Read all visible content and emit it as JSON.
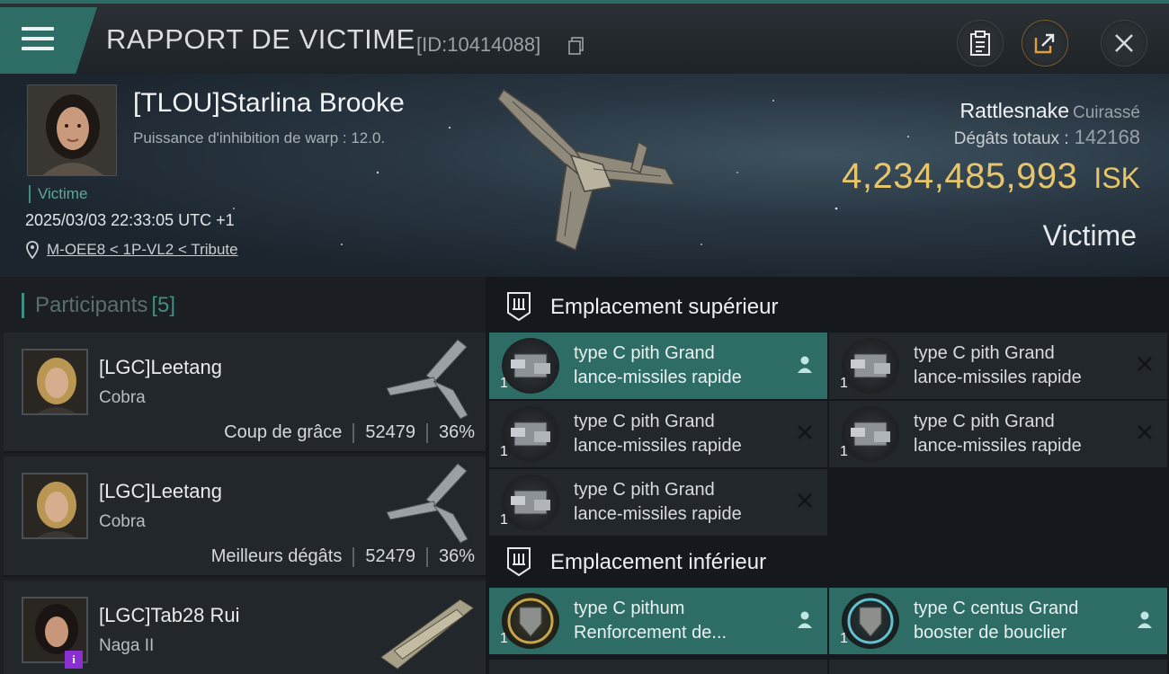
{
  "header": {
    "title": "RAPPORT DE VICTIME",
    "report_id": "[ID:10414088]",
    "buttons": [
      {
        "name": "clipboard-icon"
      },
      {
        "name": "share-icon"
      },
      {
        "name": "close-icon"
      }
    ]
  },
  "victim": {
    "name": "[TLOU]Starlina Brooke",
    "subtitle": "Puissance d'inhibition de warp : 12.0.",
    "tag": "Victime",
    "datetime": "2025/03/03 22:33:05 UTC +1",
    "location": "M-OEE8 < 1P-VL2 < Tribute",
    "ship_name": "Rattlesnake",
    "ship_class": "Cuirassé",
    "damage_label": "Dégâts totaux :",
    "damage_value": "142168",
    "isk_value": "4,234,485,993",
    "isk_unit": "ISK",
    "role": "Victime"
  },
  "participants": {
    "label": "Participants",
    "count": "[5]",
    "items": [
      {
        "name": "[LGC]Leetang",
        "ship": "Cobra",
        "tag": "Coup de grâce",
        "damage": "52479",
        "percent": "36%"
      },
      {
        "name": "[LGC]Leetang",
        "ship": "Cobra",
        "tag": "Meilleurs dégâts",
        "damage": "52479",
        "percent": "36%"
      },
      {
        "name": "[LGC]Tab28 Rui",
        "ship": "Naga II",
        "badge": "i"
      }
    ]
  },
  "slots": {
    "upper_title": "Emplacement supérieur",
    "lower_title": "Emplacement inférieur",
    "upper": [
      {
        "line1": "type C pith Grand",
        "line2": "lance-missiles rapide",
        "qty": "1",
        "status": "person",
        "active": true
      },
      {
        "line1": "type C pith Grand",
        "line2": "lance-missiles rapide",
        "qty": "1",
        "status": "x",
        "active": false
      },
      {
        "line1": "type C pith Grand",
        "line2": "lance-missiles rapide",
        "qty": "1",
        "status": "x",
        "active": false
      },
      {
        "line1": "type C pith Grand",
        "line2": "lance-missiles rapide",
        "qty": "1",
        "status": "x",
        "active": false
      },
      {
        "line1": "type C pith Grand",
        "line2": "lance-missiles rapide",
        "qty": "1",
        "status": "x",
        "active": false
      }
    ],
    "lower": [
      {
        "line1": "type C pithum",
        "line2": "Renforcement de...",
        "qty": "1",
        "status": "person",
        "active": true
      },
      {
        "line1": "type C centus Grand",
        "line2": "booster de bouclier",
        "qty": "1",
        "status": "person",
        "active": true
      }
    ]
  },
  "colors": {
    "accent": "#2e6d66",
    "isk": "#e7c56a"
  }
}
